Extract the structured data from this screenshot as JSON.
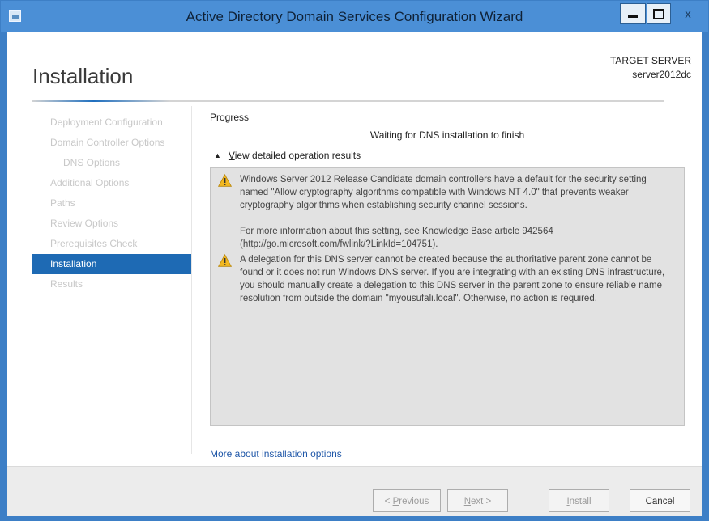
{
  "window": {
    "title": "Active Directory Domain Services Configuration Wizard",
    "controls": {
      "minimize": "—",
      "maximize": "□",
      "close": "x"
    }
  },
  "header": {
    "page_title": "Installation",
    "target_label": "TARGET SERVER",
    "target_name": "server2012dc"
  },
  "nav": {
    "items": [
      {
        "label": "Deployment Configuration",
        "state": "disabled"
      },
      {
        "label": "Domain Controller Options",
        "state": "disabled"
      },
      {
        "label": "DNS Options",
        "state": "disabled",
        "indent": true
      },
      {
        "label": "Additional Options",
        "state": "disabled"
      },
      {
        "label": "Paths",
        "state": "disabled"
      },
      {
        "label": "Review Options",
        "state": "disabled"
      },
      {
        "label": "Prerequisites Check",
        "state": "disabled"
      },
      {
        "label": "Installation",
        "state": "active"
      },
      {
        "label": "Results",
        "state": "disabled"
      }
    ]
  },
  "main": {
    "progress_label": "Progress",
    "status": "Waiting for DNS installation to finish",
    "details_toggle": {
      "hotkey": "V",
      "rest": "iew detailed operation results",
      "state": "expanded"
    },
    "messages": [
      {
        "icon": "warning-icon",
        "paragraphs": [
          "Windows Server 2012 Release Candidate domain controllers have a default for the security setting named \"Allow cryptography algorithms compatible with Windows NT 4.0\" that prevents weaker cryptography algorithms when establishing security channel sessions.",
          "For more information about this setting, see Knowledge Base article 942564 (http://go.microsoft.com/fwlink/?LinkId=104751)."
        ]
      },
      {
        "icon": "warning-icon",
        "paragraphs": [
          "A delegation for this DNS server cannot be created because the authoritative parent zone cannot be found or it does not run Windows DNS server. If you are integrating with an existing DNS infrastructure, you should manually create a delegation to this DNS server in the parent zone to ensure reliable name resolution from outside the domain \"myousufali.local\". Otherwise, no action is required."
        ]
      }
    ],
    "more_link": "More about installation options"
  },
  "footer": {
    "previous": {
      "prefix": "< ",
      "hotkey": "P",
      "rest": "revious",
      "enabled": false
    },
    "next": {
      "hotkey": "N",
      "rest": "ext >",
      "enabled": false
    },
    "install": {
      "hotkey": "I",
      "rest": "nstall",
      "enabled": false
    },
    "cancel": {
      "label": "Cancel",
      "enabled": true
    }
  },
  "colors": {
    "titlebar": "#4b8fd6",
    "nav_active": "#1e6ab4",
    "link": "#1f57a8",
    "warning": "#f2b821"
  }
}
